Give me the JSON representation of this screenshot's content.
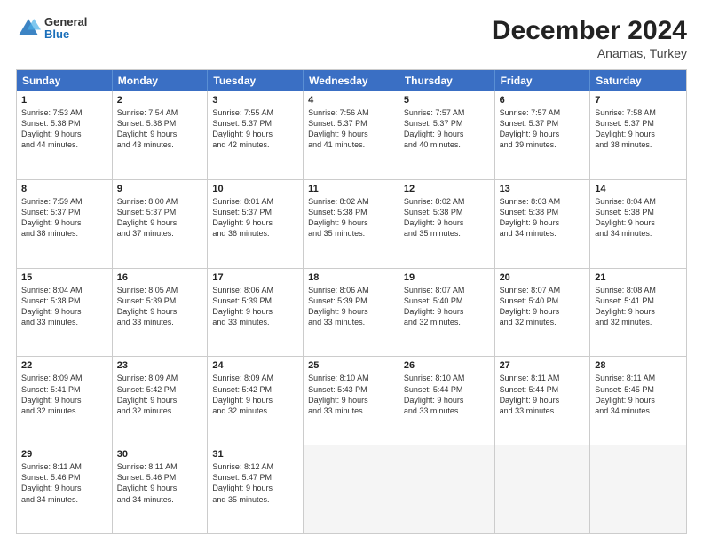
{
  "header": {
    "logo_general": "General",
    "logo_blue": "Blue",
    "month_year": "December 2024",
    "location": "Anamas, Turkey"
  },
  "weekdays": [
    "Sunday",
    "Monday",
    "Tuesday",
    "Wednesday",
    "Thursday",
    "Friday",
    "Saturday"
  ],
  "weeks": [
    [
      {
        "day": "1",
        "lines": [
          "Sunrise: 7:53 AM",
          "Sunset: 5:38 PM",
          "Daylight: 9 hours",
          "and 44 minutes."
        ]
      },
      {
        "day": "2",
        "lines": [
          "Sunrise: 7:54 AM",
          "Sunset: 5:38 PM",
          "Daylight: 9 hours",
          "and 43 minutes."
        ]
      },
      {
        "day": "3",
        "lines": [
          "Sunrise: 7:55 AM",
          "Sunset: 5:37 PM",
          "Daylight: 9 hours",
          "and 42 minutes."
        ]
      },
      {
        "day": "4",
        "lines": [
          "Sunrise: 7:56 AM",
          "Sunset: 5:37 PM",
          "Daylight: 9 hours",
          "and 41 minutes."
        ]
      },
      {
        "day": "5",
        "lines": [
          "Sunrise: 7:57 AM",
          "Sunset: 5:37 PM",
          "Daylight: 9 hours",
          "and 40 minutes."
        ]
      },
      {
        "day": "6",
        "lines": [
          "Sunrise: 7:57 AM",
          "Sunset: 5:37 PM",
          "Daylight: 9 hours",
          "and 39 minutes."
        ]
      },
      {
        "day": "7",
        "lines": [
          "Sunrise: 7:58 AM",
          "Sunset: 5:37 PM",
          "Daylight: 9 hours",
          "and 38 minutes."
        ]
      }
    ],
    [
      {
        "day": "8",
        "lines": [
          "Sunrise: 7:59 AM",
          "Sunset: 5:37 PM",
          "Daylight: 9 hours",
          "and 38 minutes."
        ]
      },
      {
        "day": "9",
        "lines": [
          "Sunrise: 8:00 AM",
          "Sunset: 5:37 PM",
          "Daylight: 9 hours",
          "and 37 minutes."
        ]
      },
      {
        "day": "10",
        "lines": [
          "Sunrise: 8:01 AM",
          "Sunset: 5:37 PM",
          "Daylight: 9 hours",
          "and 36 minutes."
        ]
      },
      {
        "day": "11",
        "lines": [
          "Sunrise: 8:02 AM",
          "Sunset: 5:38 PM",
          "Daylight: 9 hours",
          "and 35 minutes."
        ]
      },
      {
        "day": "12",
        "lines": [
          "Sunrise: 8:02 AM",
          "Sunset: 5:38 PM",
          "Daylight: 9 hours",
          "and 35 minutes."
        ]
      },
      {
        "day": "13",
        "lines": [
          "Sunrise: 8:03 AM",
          "Sunset: 5:38 PM",
          "Daylight: 9 hours",
          "and 34 minutes."
        ]
      },
      {
        "day": "14",
        "lines": [
          "Sunrise: 8:04 AM",
          "Sunset: 5:38 PM",
          "Daylight: 9 hours",
          "and 34 minutes."
        ]
      }
    ],
    [
      {
        "day": "15",
        "lines": [
          "Sunrise: 8:04 AM",
          "Sunset: 5:38 PM",
          "Daylight: 9 hours",
          "and 33 minutes."
        ]
      },
      {
        "day": "16",
        "lines": [
          "Sunrise: 8:05 AM",
          "Sunset: 5:39 PM",
          "Daylight: 9 hours",
          "and 33 minutes."
        ]
      },
      {
        "day": "17",
        "lines": [
          "Sunrise: 8:06 AM",
          "Sunset: 5:39 PM",
          "Daylight: 9 hours",
          "and 33 minutes."
        ]
      },
      {
        "day": "18",
        "lines": [
          "Sunrise: 8:06 AM",
          "Sunset: 5:39 PM",
          "Daylight: 9 hours",
          "and 33 minutes."
        ]
      },
      {
        "day": "19",
        "lines": [
          "Sunrise: 8:07 AM",
          "Sunset: 5:40 PM",
          "Daylight: 9 hours",
          "and 32 minutes."
        ]
      },
      {
        "day": "20",
        "lines": [
          "Sunrise: 8:07 AM",
          "Sunset: 5:40 PM",
          "Daylight: 9 hours",
          "and 32 minutes."
        ]
      },
      {
        "day": "21",
        "lines": [
          "Sunrise: 8:08 AM",
          "Sunset: 5:41 PM",
          "Daylight: 9 hours",
          "and 32 minutes."
        ]
      }
    ],
    [
      {
        "day": "22",
        "lines": [
          "Sunrise: 8:09 AM",
          "Sunset: 5:41 PM",
          "Daylight: 9 hours",
          "and 32 minutes."
        ]
      },
      {
        "day": "23",
        "lines": [
          "Sunrise: 8:09 AM",
          "Sunset: 5:42 PM",
          "Daylight: 9 hours",
          "and 32 minutes."
        ]
      },
      {
        "day": "24",
        "lines": [
          "Sunrise: 8:09 AM",
          "Sunset: 5:42 PM",
          "Daylight: 9 hours",
          "and 32 minutes."
        ]
      },
      {
        "day": "25",
        "lines": [
          "Sunrise: 8:10 AM",
          "Sunset: 5:43 PM",
          "Daylight: 9 hours",
          "and 33 minutes."
        ]
      },
      {
        "day": "26",
        "lines": [
          "Sunrise: 8:10 AM",
          "Sunset: 5:44 PM",
          "Daylight: 9 hours",
          "and 33 minutes."
        ]
      },
      {
        "day": "27",
        "lines": [
          "Sunrise: 8:11 AM",
          "Sunset: 5:44 PM",
          "Daylight: 9 hours",
          "and 33 minutes."
        ]
      },
      {
        "day": "28",
        "lines": [
          "Sunrise: 8:11 AM",
          "Sunset: 5:45 PM",
          "Daylight: 9 hours",
          "and 34 minutes."
        ]
      }
    ],
    [
      {
        "day": "29",
        "lines": [
          "Sunrise: 8:11 AM",
          "Sunset: 5:46 PM",
          "Daylight: 9 hours",
          "and 34 minutes."
        ]
      },
      {
        "day": "30",
        "lines": [
          "Sunrise: 8:11 AM",
          "Sunset: 5:46 PM",
          "Daylight: 9 hours",
          "and 34 minutes."
        ]
      },
      {
        "day": "31",
        "lines": [
          "Sunrise: 8:12 AM",
          "Sunset: 5:47 PM",
          "Daylight: 9 hours",
          "and 35 minutes."
        ]
      },
      {
        "day": "",
        "lines": []
      },
      {
        "day": "",
        "lines": []
      },
      {
        "day": "",
        "lines": []
      },
      {
        "day": "",
        "lines": []
      }
    ]
  ]
}
